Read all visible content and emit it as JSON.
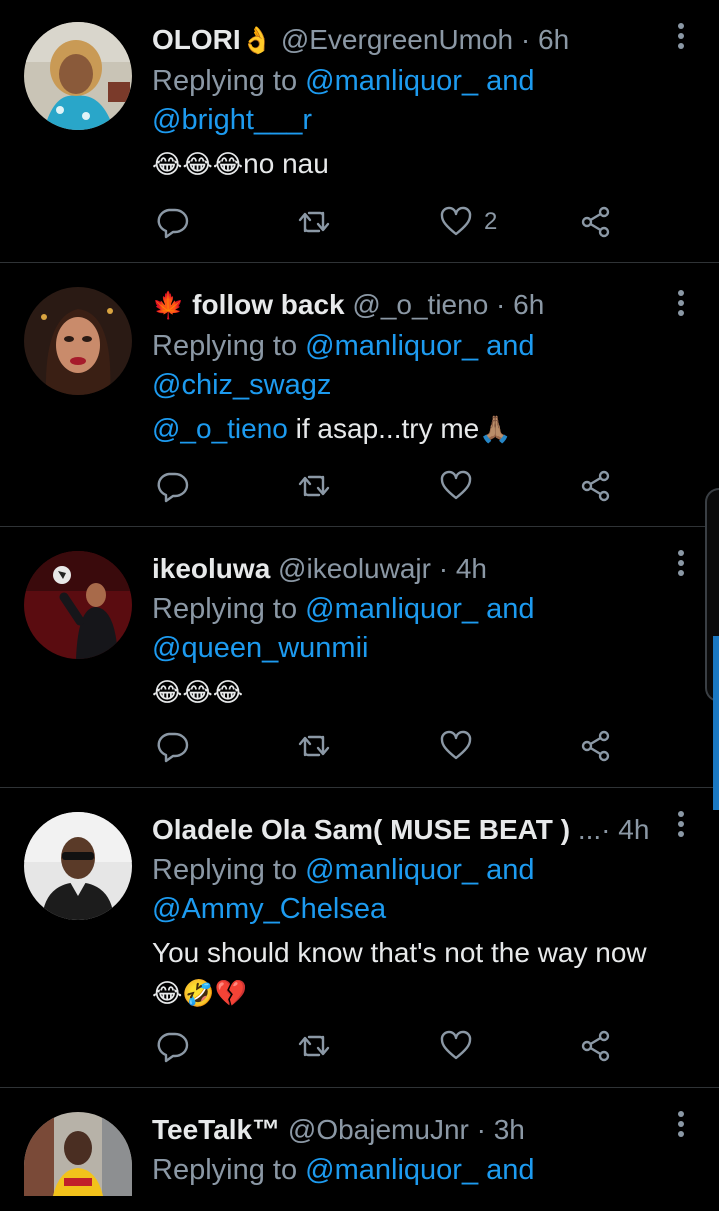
{
  "colors": {
    "background": "#000000",
    "mention": "#1d9bf0",
    "muted": "#8b98a5",
    "divider": "#2f3336"
  },
  "tweets": [
    {
      "display_name": "OLORI",
      "name_emoji": "👌",
      "handle": "@EvergreenUmoh",
      "sep": "·",
      "time": "6h",
      "reply_prefix": "Replying to",
      "reply_mention_1": "@manliquor_",
      "reply_and": "and",
      "reply_mention_2": "@bright___r",
      "body_emoji": "😂😂😂",
      "body_text": "no nau",
      "like_count": "2",
      "icons": [
        "reply-icon",
        "retweet-icon",
        "like-icon",
        "share-icon",
        "more-icon"
      ]
    },
    {
      "name_emoji": "🍁",
      "display_name": "follow back",
      "handle": "@_o_tieno",
      "sep": "·",
      "time": "6h",
      "reply_prefix": "Replying to",
      "reply_mention_1": "@manliquor_",
      "reply_and": "and",
      "reply_mention_2": "@chiz_swagz",
      "body_mention": "@_o_tieno",
      "body_text": " if asap...try me",
      "body_emoji": "🙏🏽",
      "icons": [
        "reply-icon",
        "retweet-icon",
        "like-icon",
        "share-icon",
        "more-icon"
      ]
    },
    {
      "display_name": "ikeoluwa",
      "handle": "@ikeoluwajr",
      "sep": "·",
      "time": "4h",
      "reply_prefix": "Replying to",
      "reply_mention_1": "@manliquor_",
      "reply_and": "and",
      "reply_mention_2": "@queen_wunmii",
      "body_emoji": "😂😂😂",
      "icons": [
        "reply-icon",
        "retweet-icon",
        "like-icon",
        "share-icon",
        "more-icon"
      ]
    },
    {
      "display_name": "Oladele Ola Sam( MUSE BEAT )",
      "handle": "...",
      "sep": "·",
      "time": "4h",
      "reply_prefix": "Replying to",
      "reply_mention_1": "@manliquor_",
      "reply_and": "and",
      "reply_mention_2": "@Ammy_Chelsea",
      "body_text": "You should know that's not the way now",
      "body_emoji": "😂🤣💔",
      "icons": [
        "reply-icon",
        "retweet-icon",
        "like-icon",
        "share-icon",
        "more-icon"
      ]
    },
    {
      "display_name": "TeeTalk™",
      "handle": "@ObajemuJnr",
      "sep": "·",
      "time": "3h",
      "reply_prefix": "Replying to",
      "reply_mention_1": "@manliquor_",
      "reply_and": "and",
      "icons": [
        "more-icon"
      ]
    }
  ]
}
